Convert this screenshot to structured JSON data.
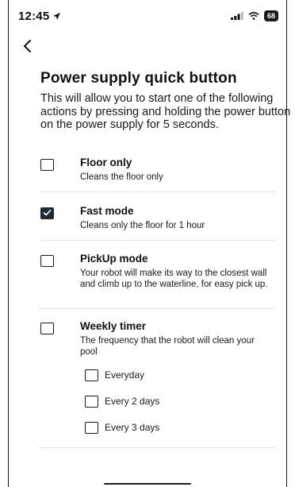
{
  "status_bar": {
    "time": "12:45",
    "battery": "68",
    "icons": [
      "location-arrow-icon",
      "signal-icon",
      "wifi-icon",
      "battery-icon"
    ]
  },
  "nav": {
    "back_icon": "chevron-left-icon"
  },
  "page": {
    "title": "Power supply quick button",
    "description": "This will allow you to start one of the following actions by pressing and holding the power button on the power supply for 5 seconds."
  },
  "options": [
    {
      "title": "Floor only",
      "description": "Cleans the floor only",
      "checked": false
    },
    {
      "title": "Fast mode",
      "description": "Cleans only the floor for 1 hour",
      "checked": true
    },
    {
      "title": "PickUp mode",
      "description": "Your robot will make its way to the closest wall and climb up to the waterline, for easy pick up.",
      "checked": false
    },
    {
      "title": "Weekly timer",
      "description": "The frequency that the robot will clean your pool",
      "checked": false,
      "frequencies": [
        {
          "label": "Everyday",
          "checked": false
        },
        {
          "label": "Every 2 days",
          "checked": false
        },
        {
          "label": "Every 3 days",
          "checked": false
        }
      ]
    }
  ],
  "colors": {
    "checked_fill": "#1f2a36",
    "divider": "#e2e2e2",
    "text": "#111111"
  }
}
